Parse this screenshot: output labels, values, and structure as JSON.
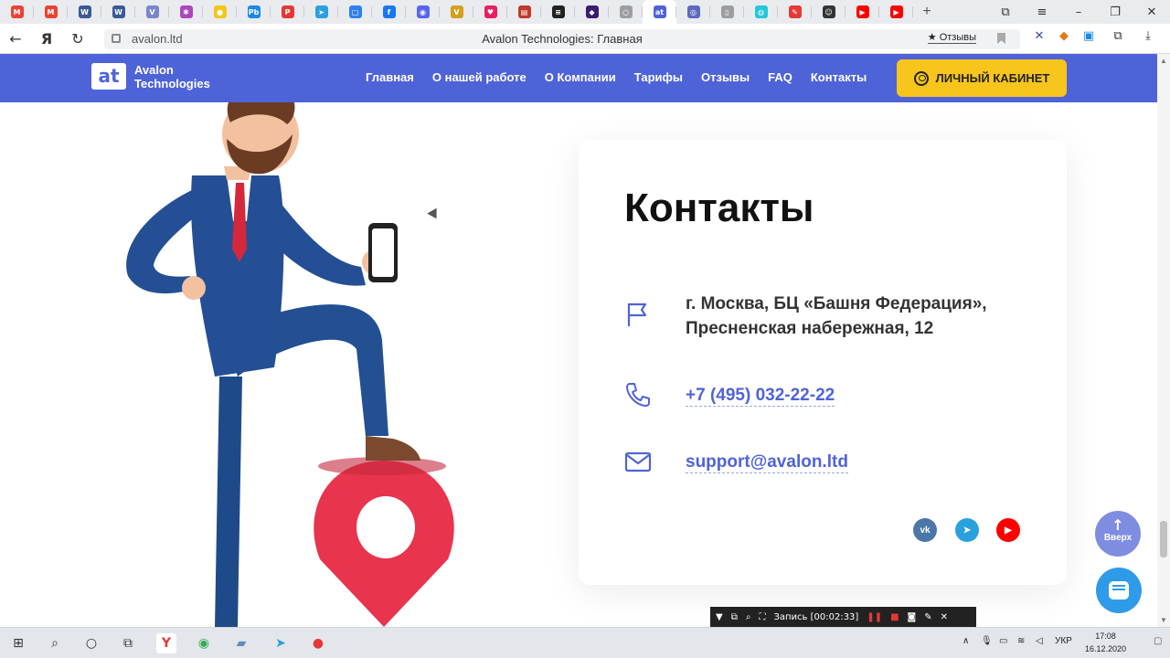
{
  "browser": {
    "tabs": [
      {
        "icon": "gmail-icon",
        "color": "#ea4335",
        "glyph": "M"
      },
      {
        "icon": "gmail-icon",
        "color": "#ea4335",
        "glyph": "M"
      },
      {
        "icon": "vk-doc-icon",
        "color": "#3b5998",
        "glyph": "W"
      },
      {
        "icon": "vk-doc-icon",
        "color": "#3b5998",
        "glyph": "W"
      },
      {
        "icon": "v-icon",
        "color": "#7986cb",
        "glyph": "V"
      },
      {
        "icon": "pinwheel-icon",
        "color": "#ab47bc",
        "glyph": "✱"
      },
      {
        "icon": "yandex-money-icon",
        "color": "#f5c518",
        "glyph": "●"
      },
      {
        "icon": "pb-icon",
        "color": "#1e88e5",
        "glyph": "Pb"
      },
      {
        "icon": "pm-icon",
        "color": "#e53935",
        "glyph": "P"
      },
      {
        "icon": "telegram-icon",
        "color": "#2aa1dd",
        "glyph": "➤"
      },
      {
        "icon": "chat-icon",
        "color": "#2f80ed",
        "glyph": "▢"
      },
      {
        "icon": "facebook-icon",
        "color": "#1877f2",
        "glyph": "f"
      },
      {
        "icon": "discord-icon",
        "color": "#5865f2",
        "glyph": "◉"
      },
      {
        "icon": "v-gold-icon",
        "color": "#d4a017",
        "glyph": "V"
      },
      {
        "icon": "heart-icon",
        "color": "#e91e63",
        "glyph": "♥"
      },
      {
        "icon": "book-icon",
        "color": "#c0392b",
        "glyph": "▤"
      },
      {
        "icon": "stripe-icon",
        "color": "#222222",
        "glyph": "≡"
      },
      {
        "icon": "dark-app-icon",
        "color": "#3a1c71",
        "glyph": "◆"
      },
      {
        "icon": "circle-icon",
        "color": "#9e9e9e",
        "glyph": "○"
      },
      {
        "icon": "avalon-icon",
        "color": "#4f63d9",
        "glyph": "at"
      },
      {
        "icon": "swirl-icon",
        "color": "#5c6bc0",
        "glyph": "◎"
      },
      {
        "icon": "document-icon",
        "color": "#9e9e9e",
        "glyph": "▯"
      },
      {
        "icon": "planet-icon",
        "color": "#26c6da",
        "glyph": "◍"
      },
      {
        "icon": "wrench-icon",
        "color": "#e53935",
        "glyph": "✎"
      },
      {
        "icon": "avatar-icon",
        "color": "#333333",
        "glyph": "☺"
      },
      {
        "icon": "youtube-icon",
        "color": "#ff0000",
        "glyph": "▶"
      },
      {
        "icon": "youtube-icon",
        "color": "#ff0000",
        "glyph": "▶"
      }
    ],
    "new_tab": "+",
    "window_controls": {
      "collections": "⧉",
      "menu": "≡",
      "minimize": "–",
      "restore": "❐",
      "close": "✕"
    },
    "nav": {
      "back": "←",
      "yandex": "Я",
      "reload": "↻"
    },
    "url": "avalon.ltd",
    "page_title": "Avalon Technologies: Главная",
    "reviews_chip": "★ Отзывы"
  },
  "site": {
    "logo_mark": "at",
    "logo_line1": "Avalon",
    "logo_line2": "Technologies",
    "nav": [
      "Главная",
      "О нашей работе",
      "О Компании",
      "Тарифы",
      "Отзывы",
      "FAQ",
      "Контакты"
    ],
    "cabinet_label": "ЛИЧНЫЙ КАБИНЕТ",
    "accent": "#4f63d9",
    "button_color": "#f7c51b"
  },
  "contacts": {
    "title": "Контакты",
    "address_line1": "г. Москва, БЦ «Башня Федерация»,",
    "address_line2": "Пресненская набережная, 12",
    "phone": "+7 (495) 032-22-22",
    "email": "support@avalon.ltd",
    "social": [
      {
        "icon": "vk-icon",
        "color": "#4a76a8",
        "glyph": "vk"
      },
      {
        "icon": "telegram-icon",
        "color": "#2aa1dd",
        "glyph": "➤"
      },
      {
        "icon": "youtube-icon",
        "color": "#ff0000",
        "glyph": "▶"
      }
    ]
  },
  "floating": {
    "up_label": "Вверх",
    "up_arrow": "↑"
  },
  "recorder": {
    "label": "Запись [00:02:33]"
  },
  "taskbar": {
    "lang": "УКР",
    "time": "17:08",
    "date": "16.12.2020"
  }
}
